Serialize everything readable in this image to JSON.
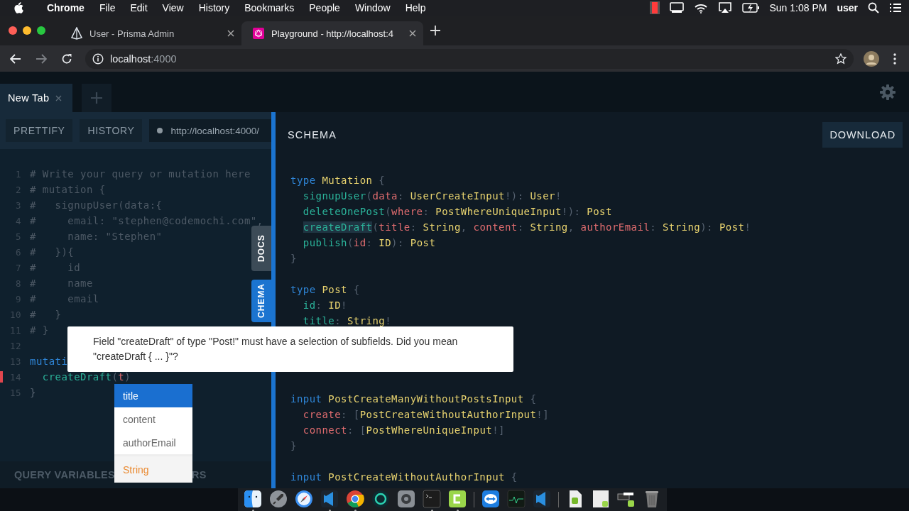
{
  "menu_bar": {
    "app": "Chrome",
    "menus": [
      "File",
      "Edit",
      "View",
      "History",
      "Bookmarks",
      "People",
      "Window",
      "Help"
    ],
    "clock": "Sun 1:08 PM",
    "user": "user"
  },
  "browser": {
    "tabs": [
      {
        "title": "User - Prisma Admin",
        "kind": "prism",
        "selected": false
      },
      {
        "title": "Playground - http://localhost:4",
        "kind": "graphql",
        "selected": true
      }
    ],
    "address": {
      "host": "localhost",
      "port": ":4000"
    }
  },
  "playground": {
    "tabs": [
      {
        "title": "New Tab",
        "selected": true
      }
    ],
    "toolbar": {
      "buttons": [
        "PRETTIFY",
        "HISTORY"
      ],
      "endpoint": "http://localhost:4000/"
    },
    "editor": {
      "lines": [
        {
          "number": "1",
          "tokens": [
            {
              "kind": "comment",
              "text": "# Write your query or mutation here"
            }
          ]
        },
        {
          "number": "2",
          "tokens": [
            {
              "kind": "comment",
              "text": "# mutation {"
            }
          ]
        },
        {
          "number": "3",
          "tokens": [
            {
              "kind": "comment",
              "text": "#   signupUser(data:{"
            }
          ]
        },
        {
          "number": "4",
          "tokens": [
            {
              "kind": "comment",
              "text": "#     email: \"stephen@codemochi.com\","
            }
          ]
        },
        {
          "number": "5",
          "tokens": [
            {
              "kind": "comment",
              "text": "#     name: \"Stephen\""
            }
          ]
        },
        {
          "number": "6",
          "tokens": [
            {
              "kind": "comment",
              "text": "#   }){"
            }
          ]
        },
        {
          "number": "7",
          "tokens": [
            {
              "kind": "comment",
              "text": "#     id"
            }
          ]
        },
        {
          "number": "8",
          "tokens": [
            {
              "kind": "comment",
              "text": "#     name"
            }
          ]
        },
        {
          "number": "9",
          "tokens": [
            {
              "kind": "comment",
              "text": "#     email"
            }
          ]
        },
        {
          "number": "10",
          "tokens": [
            {
              "kind": "comment",
              "text": "#   }"
            }
          ]
        },
        {
          "number": "11",
          "tokens": [
            {
              "kind": "comment",
              "text": "# }"
            }
          ]
        },
        {
          "number": "12",
          "blank": true
        },
        {
          "number": "13",
          "tokens": [
            {
              "kind": "keyword",
              "text": "mutati"
            }
          ]
        },
        {
          "number": "14",
          "error": true,
          "tokens": [
            {
              "kind": "field",
              "text": "  createDraft"
            },
            {
              "kind": "punct",
              "text": "("
            },
            {
              "kind": "arg",
              "text": "t"
            },
            {
              "kind": "punct",
              "text": ")"
            }
          ]
        },
        {
          "number": "15",
          "tokens": [
            {
              "kind": "punct",
              "text": "}"
            }
          ]
        }
      ]
    },
    "bottom_tabs": [
      "QUERY VARIABLES",
      "RS"
    ],
    "side_tabs": [
      {
        "label": "DOCS",
        "selected": false
      },
      {
        "label": "CHEMA",
        "selected": true
      }
    ],
    "schema": {
      "title": "SCHEMA",
      "download": "DOWNLOAD",
      "lines": [
        {
          "tokens": [
            {
              "kind": "keyword",
              "text": "type "
            },
            {
              "kind": "type",
              "text": "Mutation"
            },
            {
              "kind": "punct",
              "text": " {"
            }
          ]
        },
        {
          "tokens": [
            {
              "kind": "field",
              "text": "  signupUser"
            },
            {
              "kind": "punct",
              "text": "("
            },
            {
              "kind": "arg",
              "text": "data"
            },
            {
              "kind": "punct",
              "text": ": "
            },
            {
              "kind": "type",
              "text": "UserCreateInput"
            },
            {
              "kind": "punct",
              "text": "!): "
            },
            {
              "kind": "type",
              "text": "User"
            },
            {
              "kind": "punct",
              "text": "!"
            }
          ]
        },
        {
          "tokens": [
            {
              "kind": "field",
              "text": "  deleteOnePost"
            },
            {
              "kind": "punct",
              "text": "("
            },
            {
              "kind": "arg",
              "text": "where"
            },
            {
              "kind": "punct",
              "text": ": "
            },
            {
              "kind": "type",
              "text": "PostWhereUniqueInput"
            },
            {
              "kind": "punct",
              "text": "!): "
            },
            {
              "kind": "type",
              "text": "Post"
            }
          ]
        },
        {
          "tokens": [
            {
              "kind": "field",
              "text": "  createDraft",
              "match": true
            },
            {
              "kind": "punct",
              "text": "("
            },
            {
              "kind": "arg",
              "text": "title"
            },
            {
              "kind": "punct",
              "text": ": "
            },
            {
              "kind": "type",
              "text": "String"
            },
            {
              "kind": "punct",
              "text": ", "
            },
            {
              "kind": "arg",
              "text": "content"
            },
            {
              "kind": "punct",
              "text": ": "
            },
            {
              "kind": "type",
              "text": "String"
            },
            {
              "kind": "punct",
              "text": ", "
            },
            {
              "kind": "arg",
              "text": "authorEmail"
            },
            {
              "kind": "punct",
              "text": ": "
            },
            {
              "kind": "type",
              "text": "String"
            },
            {
              "kind": "punct",
              "text": "): "
            },
            {
              "kind": "type",
              "text": "Post"
            },
            {
              "kind": "punct",
              "text": "!"
            }
          ]
        },
        {
          "tokens": [
            {
              "kind": "field",
              "text": "  publish"
            },
            {
              "kind": "punct",
              "text": "("
            },
            {
              "kind": "arg",
              "text": "id"
            },
            {
              "kind": "punct",
              "text": ": "
            },
            {
              "kind": "type",
              "text": "ID"
            },
            {
              "kind": "punct",
              "text": "): "
            },
            {
              "kind": "type",
              "text": "Post"
            }
          ]
        },
        {
          "tokens": [
            {
              "kind": "punct",
              "text": "}"
            }
          ]
        },
        {
          "blank": true
        },
        {
          "tokens": [
            {
              "kind": "keyword",
              "text": "type "
            },
            {
              "kind": "type",
              "text": "Post"
            },
            {
              "kind": "punct",
              "text": " {"
            }
          ]
        },
        {
          "tokens": [
            {
              "kind": "field",
              "text": "  id"
            },
            {
              "kind": "punct",
              "text": ": "
            },
            {
              "kind": "type",
              "text": "ID"
            },
            {
              "kind": "punct",
              "text": "!"
            }
          ]
        },
        {
          "tokens": [
            {
              "kind": "field",
              "text": "  title"
            },
            {
              "kind": "punct",
              "text": ": "
            },
            {
              "kind": "type",
              "text": "String"
            },
            {
              "kind": "punct",
              "text": "!"
            }
          ]
        },
        {
          "blank": true
        },
        {
          "blank": true
        },
        {
          "blank": true
        },
        {
          "blank": true
        },
        {
          "tokens": [
            {
              "kind": "keyword",
              "text": "input "
            },
            {
              "kind": "type",
              "text": "PostCreateManyWithoutPostsInput"
            },
            {
              "kind": "punct",
              "text": " {"
            }
          ]
        },
        {
          "tokens": [
            {
              "kind": "arg",
              "text": "  create"
            },
            {
              "kind": "punct",
              "text": ": ["
            },
            {
              "kind": "type",
              "text": "PostCreateWithoutAuthorInput"
            },
            {
              "kind": "punct",
              "text": "!]"
            }
          ]
        },
        {
          "tokens": [
            {
              "kind": "arg",
              "text": "  connect"
            },
            {
              "kind": "punct",
              "text": ": ["
            },
            {
              "kind": "type",
              "text": "PostWhereUniqueInput"
            },
            {
              "kind": "punct",
              "text": "!]"
            }
          ]
        },
        {
          "tokens": [
            {
              "kind": "punct",
              "text": "}"
            }
          ]
        },
        {
          "blank": true
        },
        {
          "tokens": [
            {
              "kind": "keyword",
              "text": "input "
            },
            {
              "kind": "type",
              "text": "PostCreateWithoutAuthorInput"
            },
            {
              "kind": "punct",
              "text": " {"
            }
          ]
        }
      ]
    },
    "error_tooltip": "Field \"createDraft\" of type \"Post!\" must have a selection of subfields. Did you mean \"createDraft { ... }\"?",
    "autocomplete": {
      "items": [
        {
          "label": "title",
          "selected": true
        },
        {
          "label": "content",
          "selected": false
        },
        {
          "label": "authorEmail",
          "selected": false
        }
      ],
      "type": "String"
    }
  },
  "dock": {
    "groups": [
      [
        {
          "kind": "finder",
          "running": true
        },
        {
          "kind": "rocket",
          "running": false
        },
        {
          "kind": "compass",
          "running": false
        },
        {
          "kind": "code",
          "running": true
        },
        {
          "kind": "browser",
          "running": true
        },
        {
          "kind": "ring",
          "running": false
        },
        {
          "kind": "gear",
          "running": false
        },
        {
          "kind": "terminal",
          "running": true
        },
        {
          "kind": "letter",
          "running": true
        }
      ],
      [
        {
          "kind": "arrows",
          "running": false
        },
        {
          "kind": "monitor",
          "running": false
        },
        {
          "kind": "code",
          "running": false
        }
      ],
      [
        {
          "kind": "doc-green",
          "running": false
        },
        {
          "kind": "doc-white",
          "running": false
        },
        {
          "kind": "windows",
          "running": false
        },
        {
          "kind": "trash",
          "running": false
        }
      ]
    ]
  }
}
